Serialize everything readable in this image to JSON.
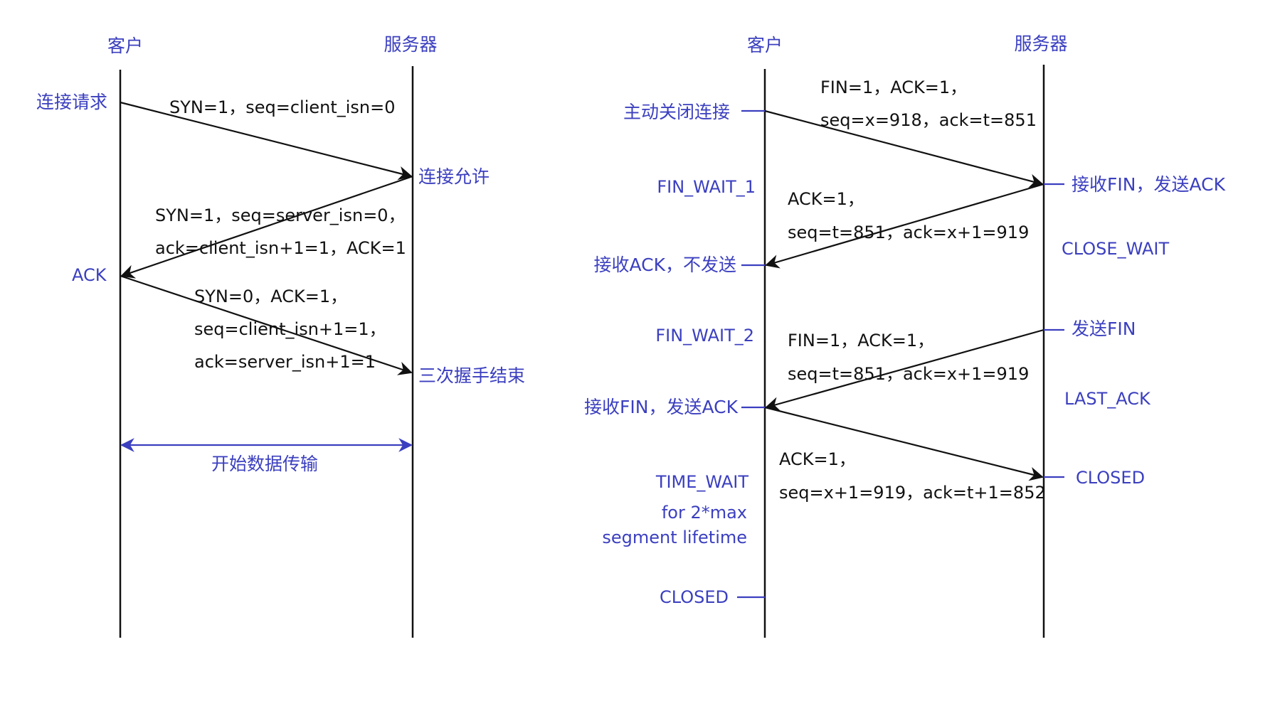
{
  "colors": {
    "annotation": "#3b3fbf",
    "lines": "#111111"
  },
  "handshake": {
    "client_title": "客户",
    "server_title": "服务器",
    "client_request": "连接请求",
    "server_allow": "连接允许",
    "client_ack": "ACK",
    "handshake_end": "三次握手结束",
    "data_transfer": "开始数据传输",
    "msg1": "SYN=1，seq=client_isn=0",
    "msg2_line1": "SYN=1，seq=server_isn=0，",
    "msg2_line2": "ack=client_isn+1=1，ACK=1",
    "msg3_line1": "SYN=0，ACK=1，",
    "msg3_line2": "seq=client_isn+1=1，",
    "msg3_line3": "ack=server_isn+1=1"
  },
  "teardown": {
    "client_title": "客户",
    "server_title": "服务器",
    "active_close": "主动关闭连接",
    "fin_wait_1": "FIN_WAIT_1",
    "recv_ack_no_send": "接收ACK，不发送",
    "fin_wait_2": "FIN_WAIT_2",
    "client_recv_fin_send_ack": "接收FIN，发送ACK",
    "time_wait": "TIME_WAIT",
    "time_wait_note1": "for 2*max",
    "time_wait_note2": "segment lifetime",
    "client_closed": "CLOSED",
    "server_recv_fin_send_ack": "接收FIN，发送ACK",
    "close_wait": "CLOSE_WAIT",
    "send_fin": "发送FIN",
    "last_ack": "LAST_ACK",
    "server_closed": "CLOSED",
    "msg1_line1": "FIN=1，ACK=1，",
    "msg1_line2": "seq=x=918，ack=t=851",
    "msg2_line1": "ACK=1，",
    "msg2_line2": "seq=t=851，ack=x+1=919",
    "msg3_line1": "FIN=1，ACK=1，",
    "msg3_line2": "seq=t=851，ack=x+1=919",
    "msg4_line1": "ACK=1，",
    "msg4_line2": "seq=x+1=919，ack=t+1=852"
  }
}
